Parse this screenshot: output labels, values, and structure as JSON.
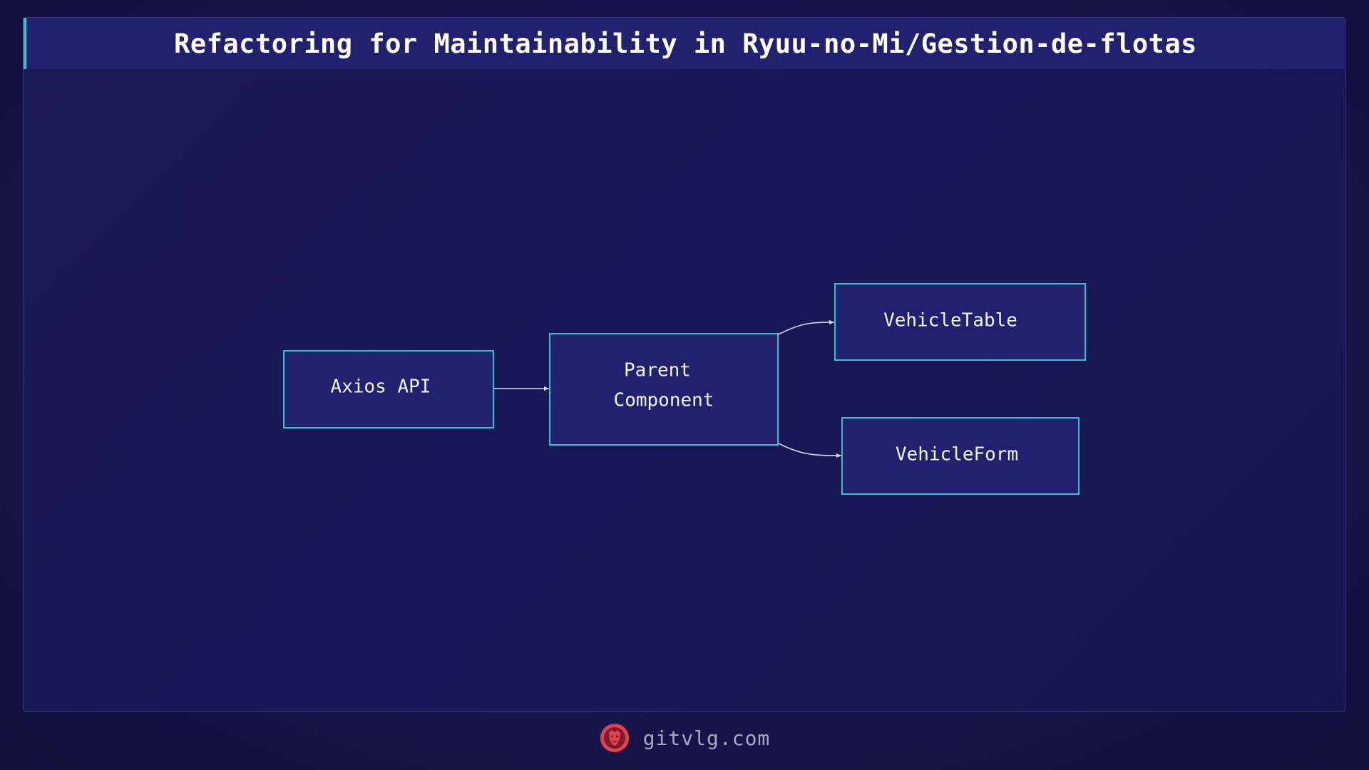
{
  "header": {
    "title": "Refactoring for Maintainability in Ryuu-no-Mi/Gestion-de-flotas"
  },
  "diagram": {
    "nodes": [
      {
        "id": "axios-api",
        "lines": [
          "Axios API"
        ]
      },
      {
        "id": "parent-component",
        "lines": [
          "Parent",
          "Component"
        ]
      },
      {
        "id": "vehicle-table",
        "lines": [
          "VehicleTable"
        ]
      },
      {
        "id": "vehicle-form",
        "lines": [
          "VehicleForm"
        ]
      }
    ],
    "edges": [
      {
        "from": "axios-api",
        "to": "parent-component"
      },
      {
        "from": "parent-component",
        "to": "vehicle-table"
      },
      {
        "from": "parent-component",
        "to": "vehicle-form"
      }
    ]
  },
  "footer": {
    "site": "gitvlg.com",
    "logo_icon": "lion-head-icon"
  },
  "colors": {
    "accent": "#35c3c9",
    "node_fill": "#22216f",
    "edge": "#d8d8e8",
    "logo": "#e0434f"
  }
}
